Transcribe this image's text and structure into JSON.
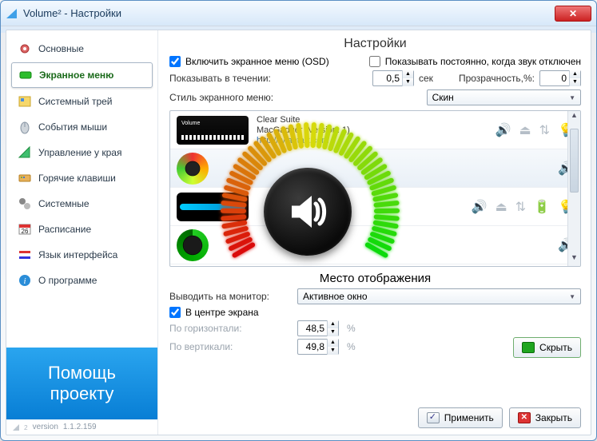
{
  "window": {
    "title": "Volume² - Настройки"
  },
  "sidebar": {
    "items": [
      {
        "label": "Основные",
        "icon": "settings-icon"
      },
      {
        "label": "Экранное меню",
        "icon": "osd-icon"
      },
      {
        "label": "Системный трей",
        "icon": "tray-icon"
      },
      {
        "label": "События мыши",
        "icon": "mouse-icon"
      },
      {
        "label": "Управление у края",
        "icon": "edge-icon"
      },
      {
        "label": "Горячие клавиши",
        "icon": "keyboard-icon"
      },
      {
        "label": "Системные",
        "icon": "system-icon"
      },
      {
        "label": "Расписание",
        "icon": "calendar-icon"
      },
      {
        "label": "Язык интерфейса",
        "icon": "language-icon"
      },
      {
        "label": "О программе",
        "icon": "about-icon"
      }
    ],
    "donate": "Помощь\nпроекту",
    "version_prefix": "version",
    "version": "1.1.2.159",
    "version_mark": "2"
  },
  "settings": {
    "heading": "Настройки",
    "enable_osd": "Включить экранное меню (OSD)",
    "show_when_muted": "Показывать постоянно, когда звук отключен",
    "show_duration_label": "Показывать в течении:",
    "show_duration_value": "0,5",
    "show_duration_unit": "сек",
    "transparency_label": "Прозрачность,%:",
    "transparency_value": "0",
    "style_label": "Стиль экранного меню:",
    "style_selected": "Скин",
    "skins": [
      {
        "name": "Clear Suite",
        "sub": "MacGadger (Version: 1)",
        "url": "http://                  viantart.com"
      },
      {
        "name": "",
        "sub": "",
        "url": ""
      },
      {
        "name": "",
        "sub": "",
        "url": ""
      },
      {
        "name": "",
        "sub": "",
        "url": ""
      }
    ]
  },
  "placement": {
    "heading": "Место отображения",
    "monitor_label": "Выводить на монитор:",
    "monitor_selected": "Активное окно",
    "center_label": "В центре экрана",
    "horiz_label": "По горизонтали:",
    "horiz_value": "48,5",
    "vert_label": "По вертикали:",
    "vert_value": "49,8",
    "percent": "%"
  },
  "buttons": {
    "hide": "Скрыть",
    "apply": "Применить",
    "close": "Закрыть"
  }
}
